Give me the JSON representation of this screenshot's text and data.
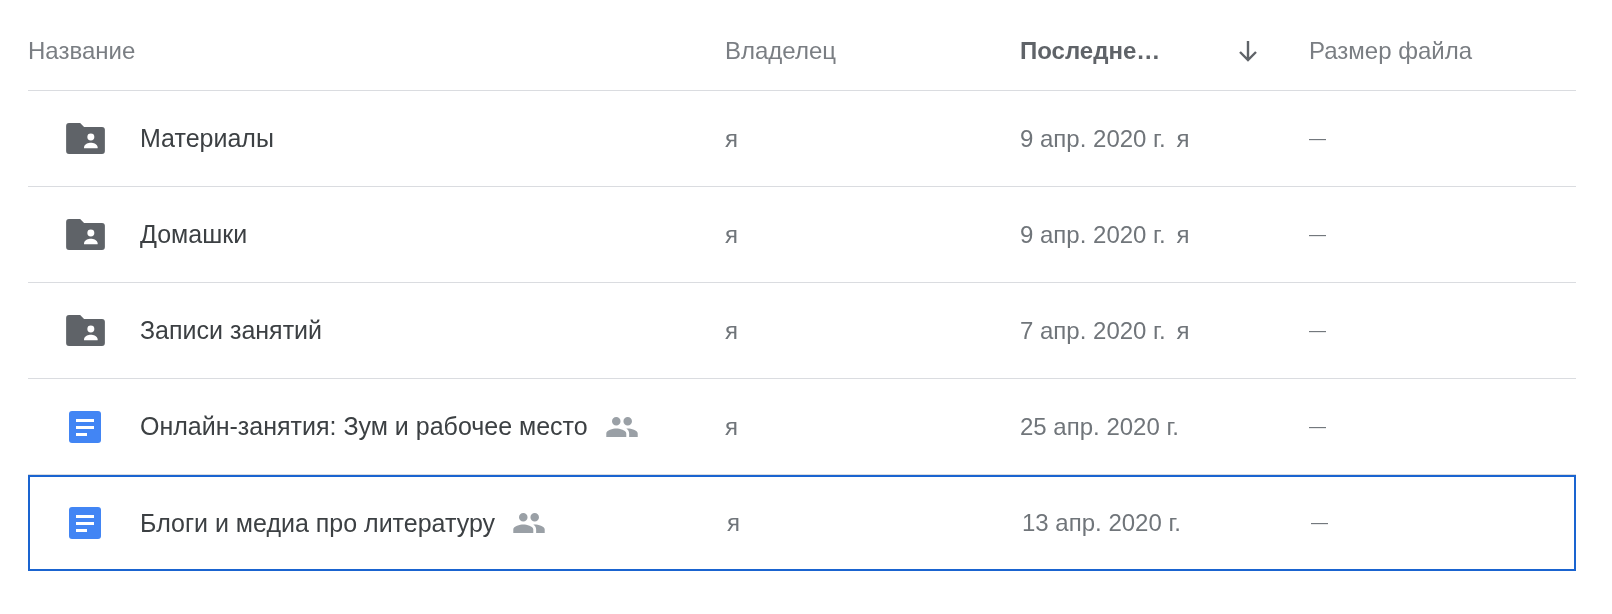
{
  "table": {
    "columns": [
      {
        "label": "Название",
        "sorted": false
      },
      {
        "label": "Владелец",
        "sorted": false
      },
      {
        "label": "Последне…",
        "sorted": true
      },
      {
        "label": "Размер файла",
        "sorted": false
      }
    ],
    "rows": [
      {
        "kind": "shared-folder",
        "name": "Материалы",
        "shared": false,
        "owner": "я",
        "modified": "9 апр. 2020 г.",
        "modified_by": "я",
        "size": "—",
        "selected": false
      },
      {
        "kind": "shared-folder",
        "name": "Домашки",
        "shared": false,
        "owner": "я",
        "modified": "9 апр. 2020 г.",
        "modified_by": "я",
        "size": "—",
        "selected": false
      },
      {
        "kind": "shared-folder",
        "name": "Записи занятий",
        "shared": false,
        "owner": "я",
        "modified": "7 апр. 2020 г.",
        "modified_by": "я",
        "size": "—",
        "selected": false
      },
      {
        "kind": "document",
        "name": "Онлайн-занятия: Зум и рабочее место",
        "shared": true,
        "owner": "я",
        "modified": "25 апр. 2020 г.",
        "size": "—",
        "selected": false
      },
      {
        "kind": "document",
        "name": "Блоги и медиа про литературу",
        "shared": true,
        "owner": "я",
        "modified": "13 апр. 2020 г.",
        "size": "—",
        "selected": true
      }
    ]
  }
}
